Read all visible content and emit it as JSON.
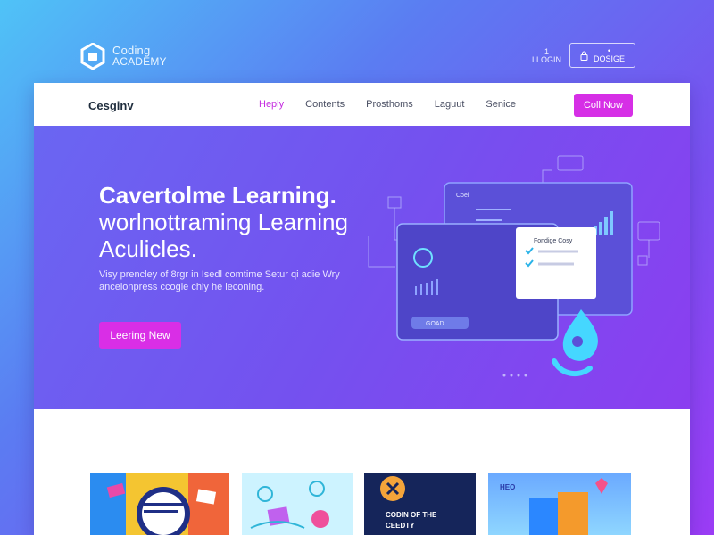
{
  "topbar": {
    "logo_line1": "Coding",
    "logo_line2": "ACADEMY",
    "user_line1": "1",
    "user_line2": "LLOGIN",
    "signup_line1": "•",
    "signup_line2": "DOSIGE"
  },
  "nav": {
    "brand": "Cesginv",
    "links": [
      "Heply",
      "Contents",
      "Prosthoms",
      "Laguut",
      "Senice"
    ],
    "cta": "Coll Now"
  },
  "hero": {
    "title_line1": "Cavertolme Learning.",
    "title_line2": "worlnottraming Learning",
    "title_line3": "Aculicles.",
    "desc_line1": "Visy prencley of 8rgr in Isedl comtime Setur qi adie Wry",
    "desc_line2": "ancelonpress ccogle chly he leconing.",
    "button": "Leering New"
  },
  "illustration": {
    "panel_title": "Fondige Cosy",
    "window_label": "Coel",
    "chip_label": "GOAD"
  },
  "thumbnails": {
    "t3_caption_line1": "CODIN OF THE",
    "t3_caption_line2": "CEEDTY",
    "t4_tag": "HEO"
  },
  "colors": {
    "accent": "#d62fe6",
    "active_link": "#c52be0",
    "hero_start": "#6a66f2",
    "hero_end": "#8b3ef0"
  },
  "icons": [
    "logo-hexagon-icon",
    "lock-icon",
    "check-icon",
    "chart-icon",
    "droplet-icon"
  ]
}
